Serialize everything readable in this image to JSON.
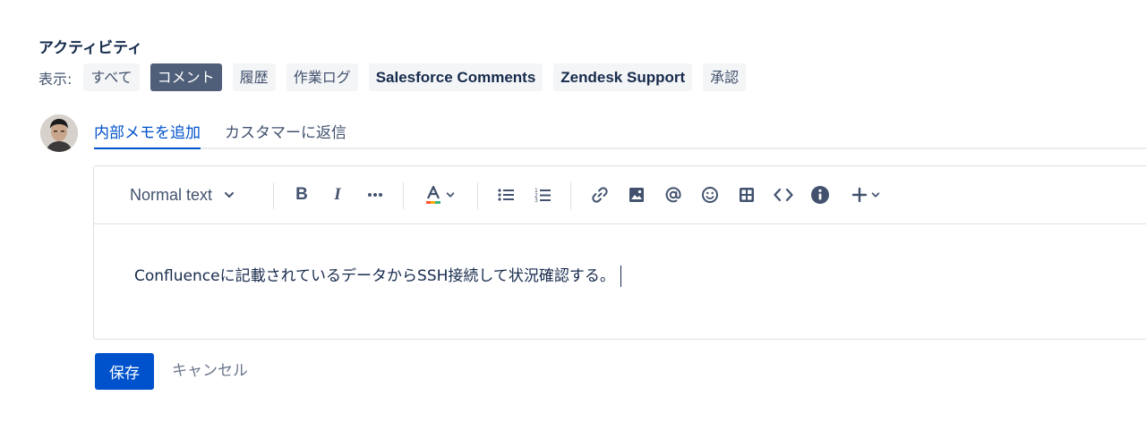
{
  "activity": {
    "title": "アクティビティ",
    "show_label": "表示:",
    "filters": [
      {
        "label": "すべて",
        "active": false
      },
      {
        "label": "コメント",
        "active": true
      },
      {
        "label": "履歴",
        "active": false
      },
      {
        "label": "作業ログ",
        "active": false
      },
      {
        "label": "Salesforce Comments",
        "active": false
      },
      {
        "label": "Zendesk Support",
        "active": false
      },
      {
        "label": "承認",
        "active": false
      }
    ]
  },
  "comment": {
    "tabs": [
      {
        "label": "内部メモを追加",
        "active": true
      },
      {
        "label": "カスタマーに返信",
        "active": false
      }
    ],
    "toolbar": {
      "text_style": "Normal text",
      "icons": [
        "bold-icon",
        "italic-icon",
        "more-formatting-icon",
        "text-color-icon",
        "bullet-list-icon",
        "numbered-list-icon",
        "link-icon",
        "image-icon",
        "mention-icon",
        "emoji-icon",
        "table-icon",
        "code-icon",
        "info-panel-icon",
        "insert-more-icon"
      ]
    },
    "content": "Confluenceに記載されているデータからSSH接続して状況確認する。",
    "save_label": "保存",
    "cancel_label": "キャンセル"
  },
  "colors": {
    "accent": "#0052cc",
    "active_chip": "#505f79",
    "chip_bg": "#f4f5f7"
  }
}
